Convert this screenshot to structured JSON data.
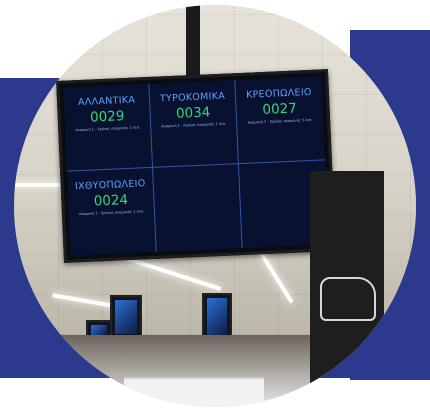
{
  "display": {
    "sections": [
      {
        "title": "ΑΛΛΑΝΤΙΚΑ",
        "number": "0029",
        "caption": "Αναμονή 1 · Χρόνος αναμονής 1 λεπ."
      },
      {
        "title": "ΤΥΡΟΚΟΜΙΚΑ",
        "number": "0034",
        "caption": "Αναμονή 1 · Χρόνος αναμονής 1 λεπ."
      },
      {
        "title": "ΚΡΕΟΠΩΛΕΙΟ",
        "number": "0027",
        "caption": "Αναμονή 3 · Χρόνος αναμονής 5 λεπ."
      },
      {
        "title": "ΙΧΘΥΟΠΩΛΕΙΟ",
        "number": "0024",
        "caption": "Αναμονή 1 · Χρόνος αναμονής 1 λεπ."
      }
    ],
    "colors": {
      "title": "#5aa0ff",
      "number": "#38d27a",
      "background": "#081230",
      "frame_blue": "#2b3a8c"
    }
  }
}
